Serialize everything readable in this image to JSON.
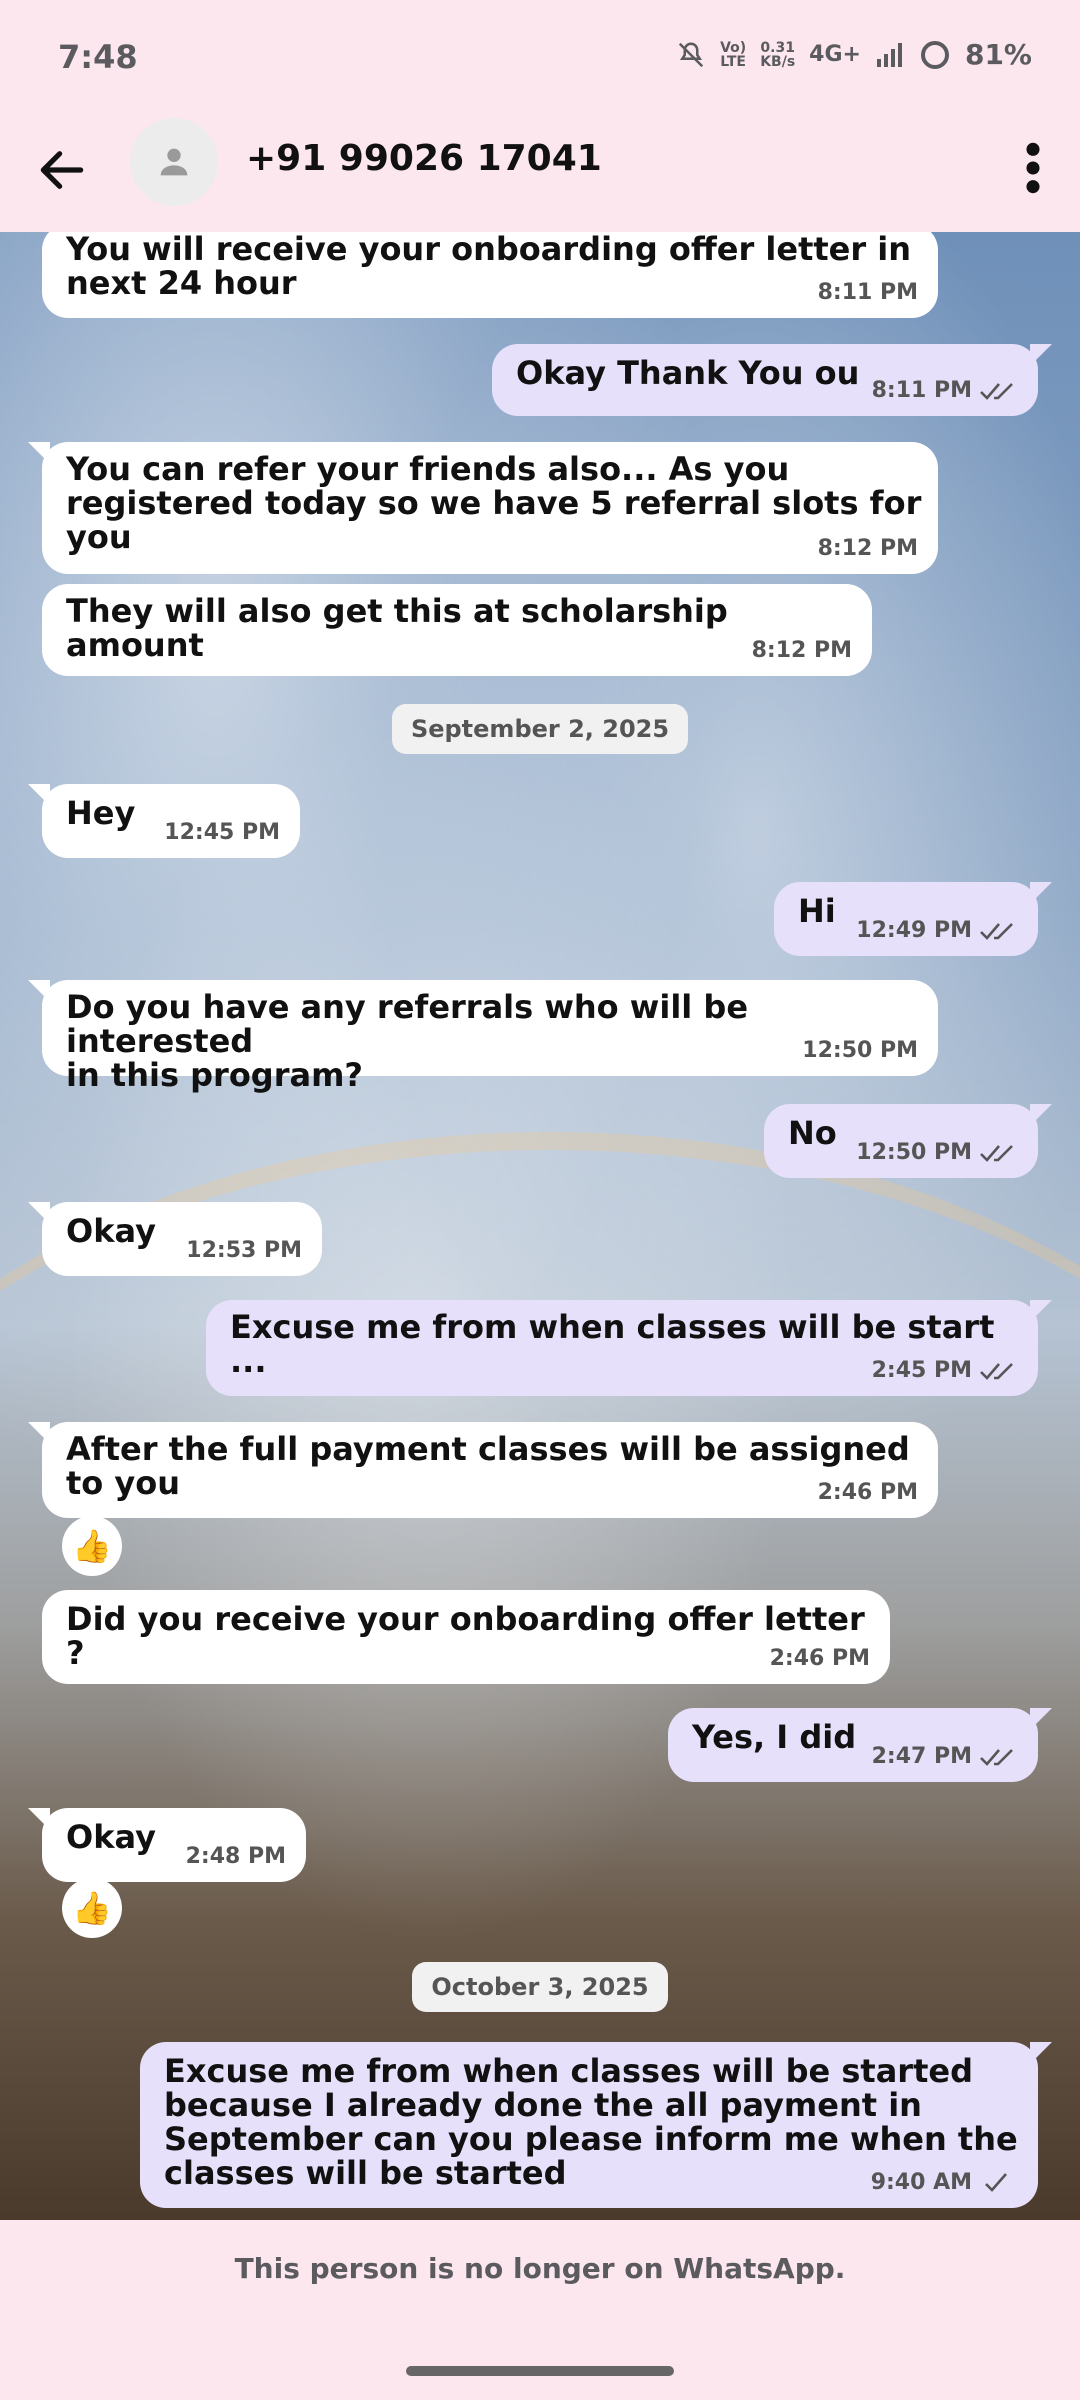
{
  "status": {
    "time": "7:48",
    "volte_top": "Vo)",
    "volte_bottom": "LTE",
    "speed_top": "0.31",
    "speed_bottom": "KB/s",
    "network": "4G+",
    "battery": "81%"
  },
  "header": {
    "contact": "+91 99026 17041"
  },
  "messages": [
    {
      "text_lines": [
        "You will receive your onboarding offer letter in",
        "next 24 hour"
      ],
      "time": "8:11 PM"
    },
    {
      "text_lines": [
        "Okay Thank You ou"
      ],
      "time": "8:11 PM"
    },
    {
      "text_lines": [
        "You can refer your friends also... As you",
        "registered today so we have 5 referral slots for",
        "you"
      ],
      "time": "8:12 PM"
    },
    {
      "text_lines": [
        "They will also get this at scholarship amount"
      ],
      "time": "8:12 PM"
    },
    {
      "text_lines": [
        "Hey"
      ],
      "time": "12:45 PM"
    },
    {
      "text_lines": [
        "Hi"
      ],
      "time": "12:49 PM"
    },
    {
      "text_lines": [
        "Do you have any referrals who will be interested",
        "in this program?"
      ],
      "time": "12:50 PM"
    },
    {
      "text_lines": [
        "No"
      ],
      "time": "12:50 PM"
    },
    {
      "text_lines": [
        "Okay"
      ],
      "time": "12:53 PM"
    },
    {
      "text_lines": [
        "Excuse me from when classes will be start ..."
      ],
      "time": "2:45 PM"
    },
    {
      "text_lines": [
        "After the full payment classes will be assigned",
        "to you"
      ],
      "time": "2:46 PM"
    },
    {
      "text_lines": [
        "Did you receive your onboarding offer letter ?"
      ],
      "time": "2:46 PM"
    },
    {
      "text_lines": [
        "Yes, I did"
      ],
      "time": "2:47 PM"
    },
    {
      "text_lines": [
        "Okay"
      ],
      "time": "2:48 PM"
    },
    {
      "text_lines": [
        "Excuse me from when classes will be started",
        "because I already done the all payment in",
        "September can you please inform me when the",
        "classes will be started"
      ],
      "time": "9:40 AM"
    }
  ],
  "dates": [
    "September 2, 2025",
    "October 3, 2025"
  ],
  "reactions": [
    "👍",
    "👍"
  ],
  "footer": {
    "text": "This person is no longer on WhatsApp."
  }
}
